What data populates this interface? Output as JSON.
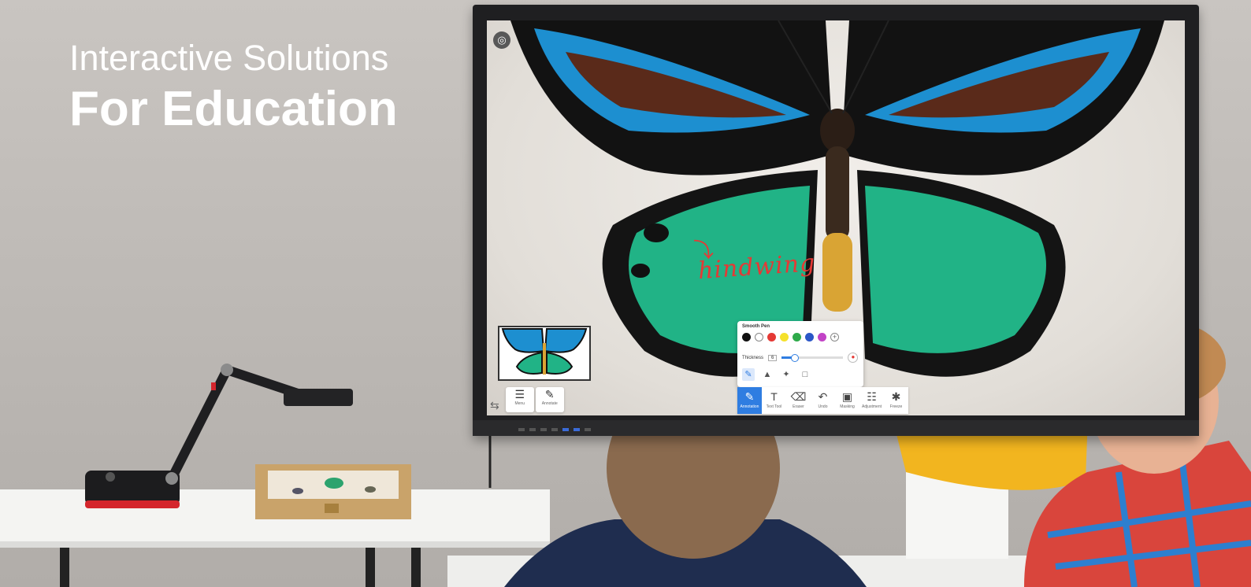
{
  "headline": {
    "line1": "Interactive Solutions",
    "line2": "For Education"
  },
  "screen": {
    "annotation_text": "hindwing",
    "annotation_color": "#e53935",
    "camera_icon": "camera-icon",
    "mini_toolbar": [
      {
        "icon": "menu-icon",
        "glyph": "☰",
        "label": "Menu"
      },
      {
        "icon": "annotate-icon",
        "glyph": "✎",
        "label": "Annotate"
      }
    ],
    "pen_panel": {
      "title": "Smooth Pen",
      "colors": [
        "#111111",
        "#ffffff",
        "#e53935",
        "#f5e12b",
        "#2eaa4a",
        "#2b57c7",
        "#c243c6"
      ],
      "thickness_label": "Thickness",
      "thickness_value": "6",
      "thickness_fraction": 0.2,
      "selected_color": "#e53935",
      "pen_styles": [
        "smooth-pen-icon",
        "highlighter-icon",
        "magic-pen-icon",
        "shape-icon"
      ]
    },
    "toolbar": [
      {
        "icon": "pen-icon",
        "glyph": "✎",
        "label": "Annotation",
        "active": true
      },
      {
        "icon": "text-icon",
        "glyph": "T",
        "label": "Text Tool",
        "active": false
      },
      {
        "icon": "eraser-icon",
        "glyph": "⌫",
        "label": "Eraser",
        "active": false
      },
      {
        "icon": "undo-icon",
        "glyph": "↶",
        "label": "Undo",
        "active": false
      },
      {
        "icon": "masking-icon",
        "glyph": "▣",
        "label": "Masking",
        "active": false
      },
      {
        "icon": "adjustment-icon",
        "glyph": "☷",
        "label": "Adjustment",
        "active": false
      },
      {
        "icon": "freeze-icon",
        "glyph": "✱",
        "label": "Freeze",
        "active": false
      }
    ]
  },
  "colors": {
    "accent": "#2f7de1",
    "wall": "#c4c0bc",
    "blouse": "#f2b51f"
  }
}
